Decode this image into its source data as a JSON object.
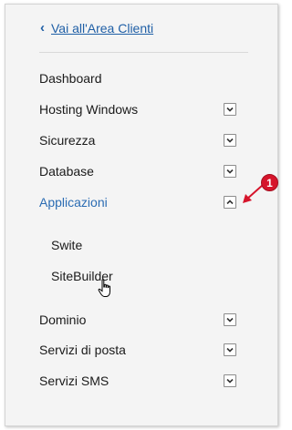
{
  "back_link": {
    "label": "Vai all'Area Clienti",
    "chevron": "‹"
  },
  "menu": [
    {
      "label": "Dashboard",
      "has_toggle": false
    },
    {
      "label": "Hosting Windows",
      "has_toggle": true,
      "expanded": false
    },
    {
      "label": "Sicurezza",
      "has_toggle": true,
      "expanded": false
    },
    {
      "label": "Database",
      "has_toggle": true,
      "expanded": false
    },
    {
      "label": "Applicazioni",
      "has_toggle": true,
      "expanded": true,
      "active": true,
      "children": [
        {
          "label": "Swite"
        },
        {
          "label": "SiteBuilder"
        }
      ]
    },
    {
      "label": "Dominio",
      "has_toggle": true,
      "expanded": false
    },
    {
      "label": "Servizi di posta",
      "has_toggle": true,
      "expanded": false
    },
    {
      "label": "Servizi SMS",
      "has_toggle": true,
      "expanded": false
    }
  ],
  "annotation": {
    "badge": "1",
    "color": "#d6142b"
  },
  "colors": {
    "link": "#1f5fa6",
    "active": "#2b6cb3",
    "panel_bg": "#f4f4f4"
  }
}
